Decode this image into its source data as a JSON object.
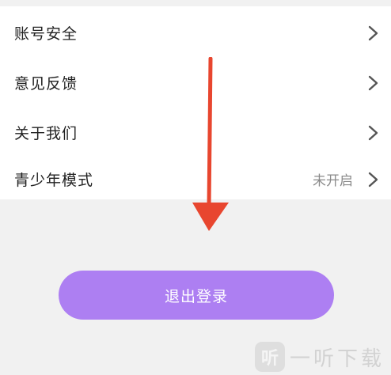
{
  "settings": {
    "items": [
      {
        "label": "账号安全",
        "value": ""
      },
      {
        "label": "意见反馈",
        "value": ""
      },
      {
        "label": "关于我们",
        "value": ""
      },
      {
        "label": "青少年模式",
        "value": "未开启"
      }
    ]
  },
  "logout": {
    "label": "退出登录"
  },
  "watermark": {
    "logo": "听",
    "text": "一听下载"
  },
  "colors": {
    "page_background": "#f1f1f1",
    "list_background": "#ffffff",
    "logout_button": "#ad7ff2",
    "arrow_annotation": "#e8462f",
    "chevron": "#555555"
  },
  "icons": {
    "row_chevron": "chevron-right-icon",
    "annotation": "arrow-down-icon"
  }
}
